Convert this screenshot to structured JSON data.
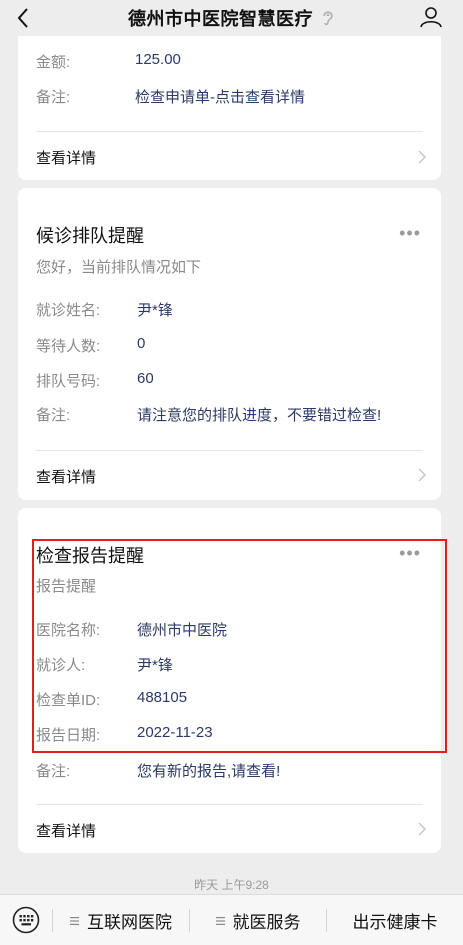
{
  "header": {
    "title": "德州市中医院智慧医疗"
  },
  "card1": {
    "rows": [
      {
        "label": "金额:",
        "value": "125.00"
      },
      {
        "label": "备注:",
        "value": "检查申请单-点击查看详情"
      }
    ],
    "detail": "查看详情"
  },
  "card2": {
    "title": "候诊排队提醒",
    "subtitle": "您好，当前排队情况如下",
    "rows": [
      {
        "label": "就诊姓名:",
        "value": "尹*锋"
      },
      {
        "label": "等待人数:",
        "value": "0"
      },
      {
        "label": "排队号码:",
        "value": "60"
      },
      {
        "label": "备注:",
        "value": "请注意您的排队进度，不要错过检查!"
      }
    ],
    "detail": "查看详情"
  },
  "card3": {
    "title": "检查报告提醒",
    "subtitle": "报告提醒",
    "rows": [
      {
        "label": "医院名称:",
        "value": "德州市中医院"
      },
      {
        "label": "就诊人:",
        "value": "尹*锋"
      },
      {
        "label": "检查单ID:",
        "value": "488105"
      },
      {
        "label": "报告日期:",
        "value": "2022-11-23"
      },
      {
        "label": "备注:",
        "value": "您有新的报告,请查看!"
      }
    ],
    "detail": "查看详情"
  },
  "timestamp": "昨天 上午9:28",
  "bottom_menu": [
    {
      "label": "互联网医院"
    },
    {
      "label": "就医服务"
    },
    {
      "label": "出示健康卡"
    }
  ],
  "colors": {
    "highlight": "#e02020",
    "value_text": "#2b3a66"
  }
}
